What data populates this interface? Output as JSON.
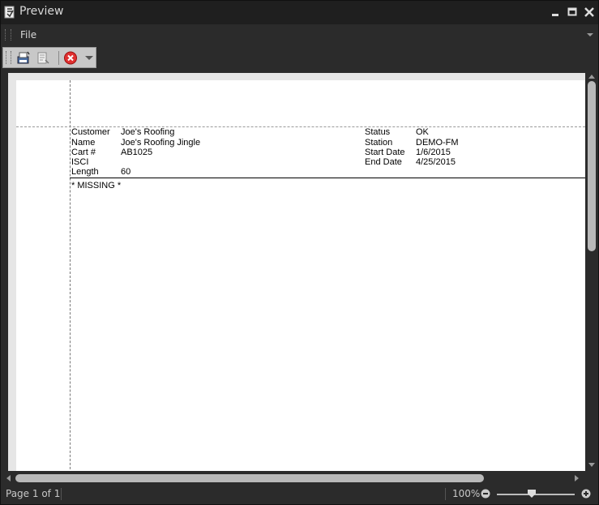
{
  "window": {
    "title": "Preview"
  },
  "menu": {
    "file": "File"
  },
  "toolbar": {
    "buttons": [
      "print-icon",
      "print-setup-icon",
      "close-preview-icon",
      "toolbar-dropdown-icon"
    ]
  },
  "report": {
    "left_fields": [
      {
        "label": "Customer",
        "value": "Joe's Roofing"
      },
      {
        "label": "Name",
        "value": "Joe's Roofing Jingle"
      },
      {
        "label": "Cart #",
        "value": "AB1025"
      },
      {
        "label": "ISCI",
        "value": ""
      },
      {
        "label": "Length",
        "value": "60"
      }
    ],
    "right_fields": [
      {
        "label": "Status",
        "value": "OK"
      },
      {
        "label": "Station",
        "value": "DEMO-FM"
      },
      {
        "label": "Start Date",
        "value": "1/6/2015"
      },
      {
        "label": "End Date",
        "value": "4/25/2015"
      }
    ],
    "missing_text": "* MISSING *"
  },
  "status": {
    "page": "Page 1 of 1",
    "zoom": "100%",
    "zoom_fraction": 0.45
  },
  "colors": {
    "chrome_bg": "#2b2b2b",
    "titlebar_bg": "#1f1f1f",
    "toolbar_bg": "#c8c8c8",
    "close_red": "#e03030"
  }
}
